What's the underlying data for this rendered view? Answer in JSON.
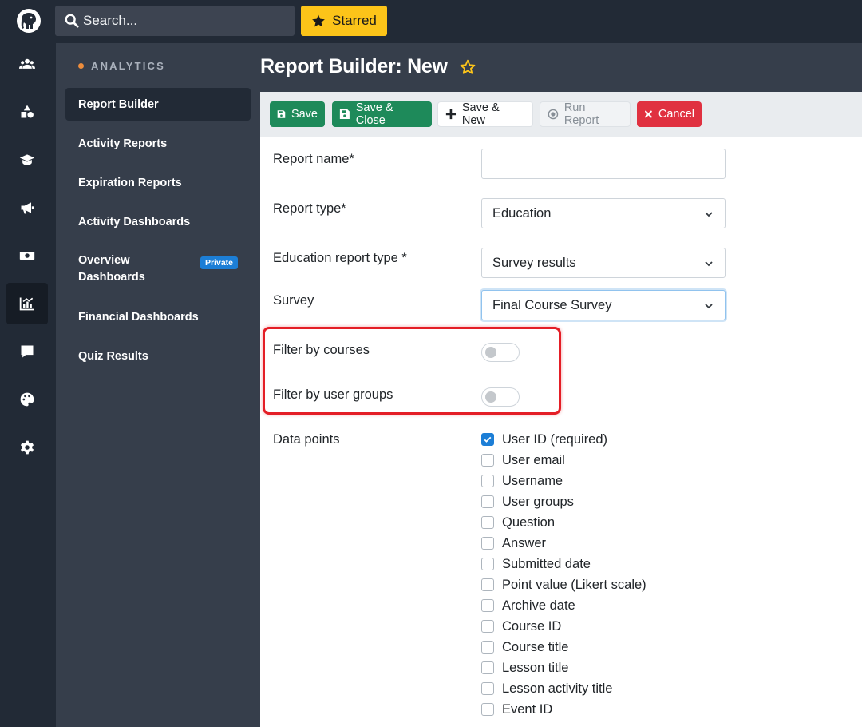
{
  "topbar": {
    "search_placeholder": "Search...",
    "starred_label": "Starred",
    "logo_icon": "elephant-logo-icon",
    "accent_color": "#fcc419"
  },
  "rail": {
    "icons": [
      "users-icon",
      "shapes-icon",
      "graduation-cap-icon",
      "megaphone-icon",
      "money-icon",
      "chart-icon",
      "comment-icon",
      "palette-icon",
      "gear-icon"
    ],
    "active": "chart-icon"
  },
  "sidebar": {
    "section_title": "ANALYTICS",
    "items": [
      {
        "label": "Report Builder"
      },
      {
        "label": "Activity Reports"
      },
      {
        "label": "Expiration Reports"
      },
      {
        "label": "Activity Dashboards"
      },
      {
        "label": "Overview Dashboards",
        "badge": "Private"
      },
      {
        "label": "Financial Dashboards"
      },
      {
        "label": "Quiz Results"
      }
    ]
  },
  "page": {
    "title": "Report Builder: New"
  },
  "toolbar": {
    "save": "Save",
    "save_close": "Save & Close",
    "save_new": "Save & New",
    "run_report": "Run Report",
    "cancel": "Cancel"
  },
  "form": {
    "report_name_label": "Report name*",
    "report_name_value": "",
    "report_type_label": "Report type*",
    "report_type_value": "Education",
    "education_type_label": "Education report type *",
    "education_type_value": "Survey results",
    "survey_label": "Survey",
    "survey_value": "Final Course Survey",
    "filter_courses_label": "Filter by courses",
    "filter_courses_on": false,
    "filter_groups_label": "Filter by user groups",
    "filter_groups_on": false,
    "data_points_label": "Data points",
    "data_points": [
      {
        "label": "User ID (required)",
        "checked": true
      },
      {
        "label": "User email",
        "checked": false
      },
      {
        "label": "Username",
        "checked": false
      },
      {
        "label": "User groups",
        "checked": false
      },
      {
        "label": "Question",
        "checked": false
      },
      {
        "label": "Answer",
        "checked": false
      },
      {
        "label": "Submitted date",
        "checked": false
      },
      {
        "label": "Point value (Likert scale)",
        "checked": false
      },
      {
        "label": "Archive date",
        "checked": false
      },
      {
        "label": "Course ID",
        "checked": false
      },
      {
        "label": "Course title",
        "checked": false
      },
      {
        "label": "Lesson title",
        "checked": false
      },
      {
        "label": "Lesson activity title",
        "checked": false
      },
      {
        "label": "Event ID",
        "checked": false
      }
    ]
  }
}
